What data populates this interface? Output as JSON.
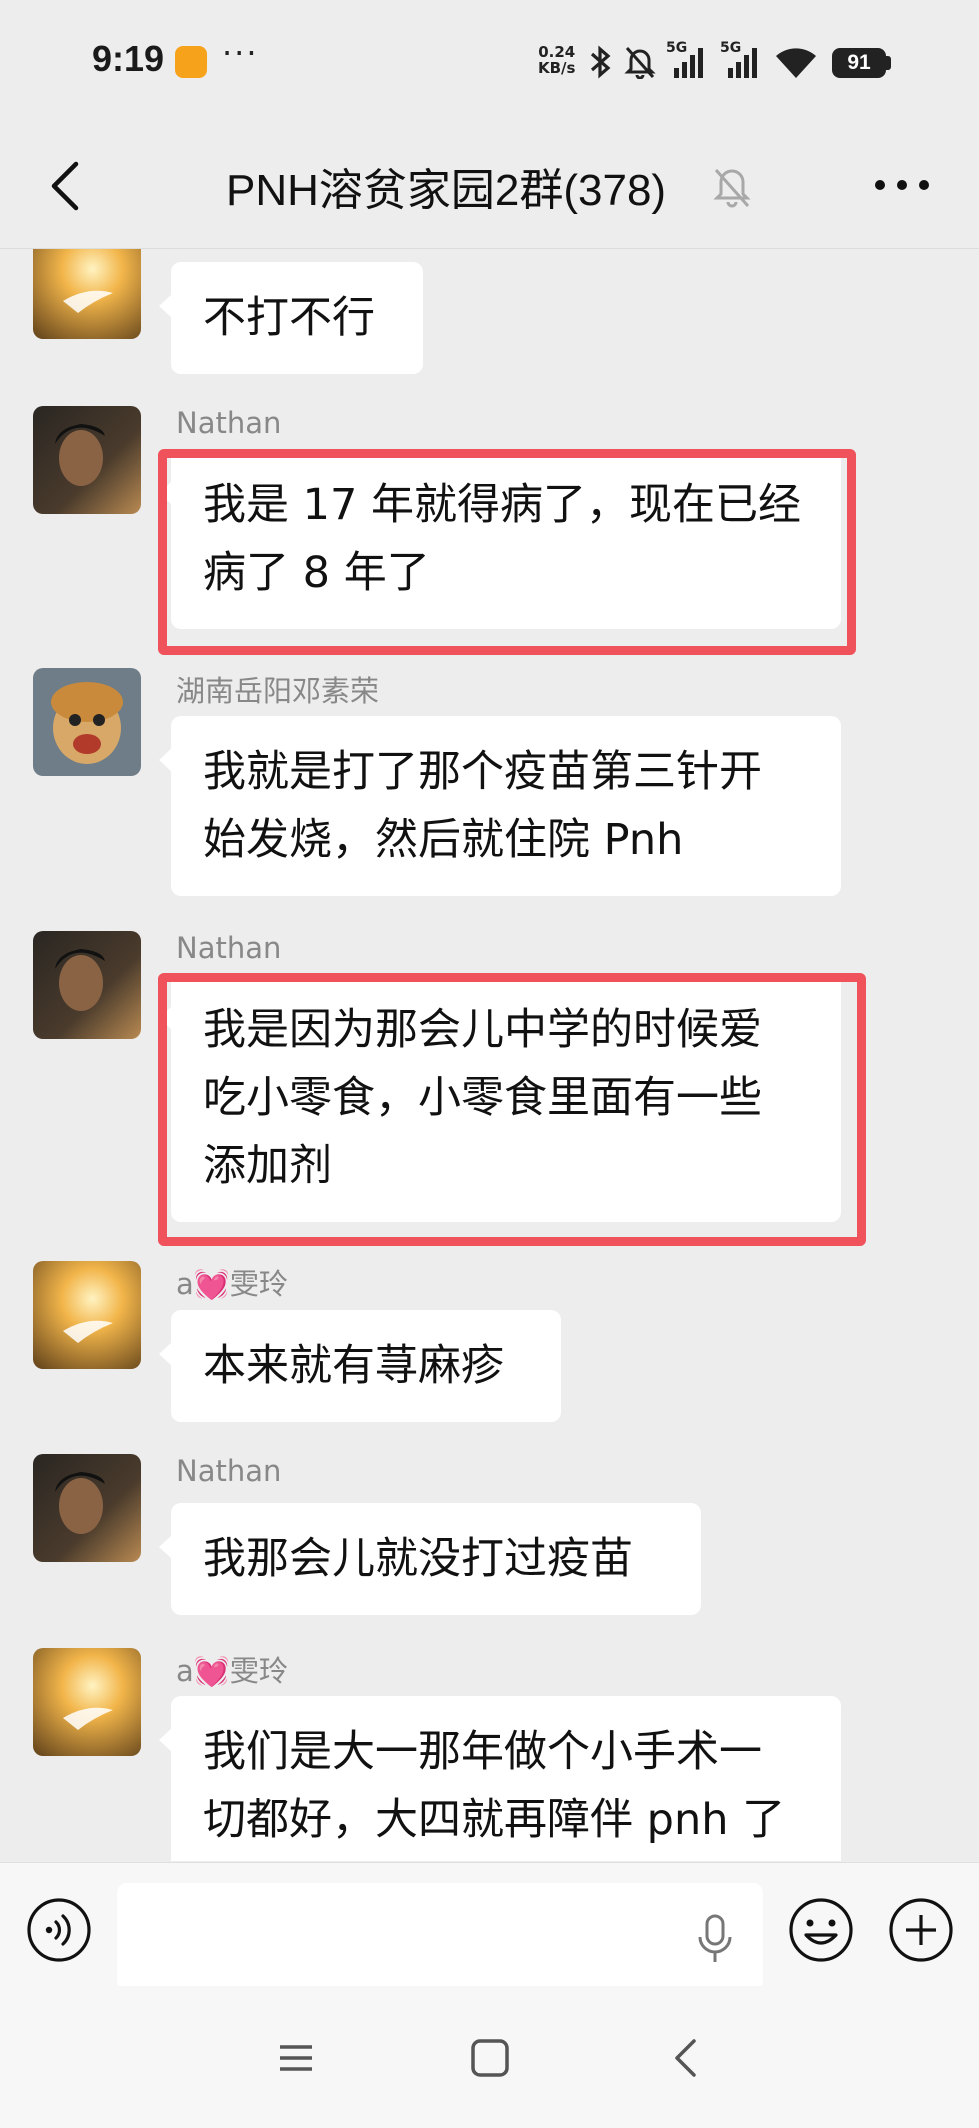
{
  "status_bar": {
    "time": "9:19",
    "more": "···",
    "net_speed_value": "0.24",
    "net_speed_unit": "KB/s",
    "signal_1": "5G",
    "signal_2": "5G",
    "battery": "91"
  },
  "header": {
    "title": "PNH溶贫家园2群(378)"
  },
  "messages": [
    {
      "sender": "",
      "text_lines": [
        "不打不行"
      ],
      "highlighted": false
    },
    {
      "sender": "Nathan",
      "text_lines": [
        "我是 17 年就得病了，现在已经",
        "病了 8 年了"
      ],
      "highlighted": true
    },
    {
      "sender": "湖南岳阳邓素荣",
      "text_lines": [
        "我就是打了那个疫苗第三针开",
        "始发烧，然后就住院 Pnh"
      ],
      "highlighted": false
    },
    {
      "sender": "Nathan",
      "text_lines": [
        "我是因为那会儿中学的时候爱",
        "吃小零食，小零食里面有一些",
        "添加剂"
      ],
      "highlighted": true
    },
    {
      "sender": "a💓雯玲",
      "text_lines": [
        "本来就有荨麻疹"
      ],
      "highlighted": false
    },
    {
      "sender": "Nathan",
      "text_lines": [
        "我那会儿就没打过疫苗"
      ],
      "highlighted": false
    },
    {
      "sender": "a💓雯玲",
      "text_lines": [
        "我们是大一那年做个小手术一",
        "切都好，大四就再障伴 pnh 了"
      ],
      "highlighted": false
    }
  ],
  "input": {
    "value": ""
  },
  "icons": {
    "back": "back-arrow-icon",
    "mute": "bell-muted-icon",
    "more": "more-dots-icon",
    "voice": "voice-icon",
    "mic": "microphone-icon",
    "emoji": "emoji-icon",
    "plus": "plus-icon",
    "nav_menu": "menu-icon",
    "nav_home": "home-icon",
    "nav_back": "nav-back-icon"
  },
  "colors": {
    "background": "#ededed",
    "bubble": "#ffffff",
    "highlight": "#f0525b",
    "sender": "#888888"
  }
}
